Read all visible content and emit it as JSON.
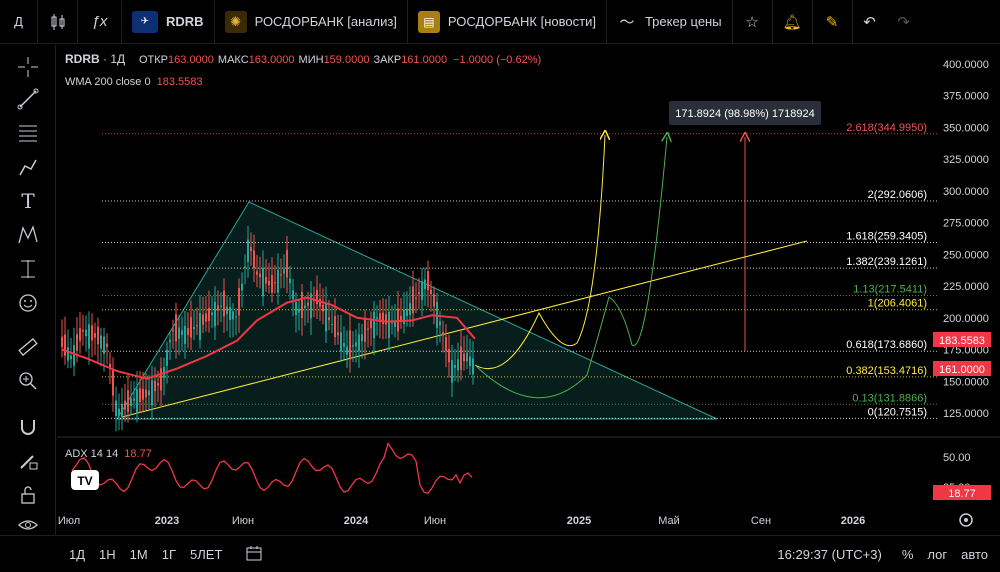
{
  "toolbar": {
    "menu_letter": "Д",
    "symbol": "RDRB",
    "analysis_label": "РОСДОРБАНК [анализ]",
    "news_label": "РОСДОРБАНК [новости]",
    "price_tracker_label": "Трекер цены"
  },
  "legend": {
    "symbol": "RDRB",
    "interval": "1Д",
    "open_label": "ОТКР",
    "open": "163.0000",
    "high_label": "МАКС",
    "high": "163.0000",
    "low_label": "МИН",
    "low": "159.0000",
    "close_label": "ЗАКР",
    "close": "161.0000",
    "change": "−1.0000 (−0.62%)",
    "wma_label": "WMA 200 close 0",
    "wma_value": "183.5583"
  },
  "adx": {
    "label": "ADX 14 14",
    "value": "18.77"
  },
  "price_axis": {
    "ticks": [
      "400.0000",
      "375.0000",
      "350.0000",
      "325.0000",
      "300.0000",
      "275.0000",
      "250.0000",
      "225.0000",
      "200.0000",
      "175.0000",
      "150.0000",
      "125.0000"
    ],
    "wma_tag": "183.5583",
    "close_tag": "161.0000"
  },
  "adx_axis": {
    "ticks": [
      "50.00",
      "25.00"
    ],
    "value_tag": "18.77"
  },
  "time_axis": {
    "ticks": [
      "Июл",
      "2023",
      "Июн",
      "2024",
      "Июн",
      "2025",
      "Май",
      "Сен",
      "2026"
    ]
  },
  "fib_levels": [
    {
      "label": "2.618(344.9950)",
      "color": "#ef5350"
    },
    {
      "label": "2(292.0606)",
      "color": "#ffffff"
    },
    {
      "label": "1.618(259.3405)",
      "color": "#ffffff"
    },
    {
      "label": "1.382(239.1261)",
      "color": "#ffffff"
    },
    {
      "label": "1.13(217.5411)",
      "color": "#4caf50"
    },
    {
      "label": "1(206.4061)",
      "color": "#ffeb3b"
    },
    {
      "label": "0.618(173.6860)",
      "color": "#ffffff"
    },
    {
      "label": "0.382(153.4716)",
      "color": "#ffeb3b"
    },
    {
      "label": "0.13(131.8866)",
      "color": "#4caf50"
    },
    {
      "label": "0(120.7515)",
      "color": "#ffffff"
    }
  ],
  "measure_label": "171.8924 (98.98%) 1718924",
  "bottom": {
    "ranges": [
      "1Д",
      "1Н",
      "1М",
      "1Г",
      "5ЛЕТ"
    ],
    "clock": "16:29:37 (UTC+3)",
    "percent": "%",
    "log": "лог",
    "auto": "авто"
  },
  "colors": {
    "wma": "#f23645",
    "fib_red": "#ef5350",
    "fib_yellow": "#ffeb3b",
    "fib_green": "#4caf50",
    "triangle": "#26a69a"
  },
  "chart_data": {
    "type": "line",
    "series": [
      {
        "name": "RDRB",
        "x": [
          "2022-07",
          "2022-10",
          "2023-01",
          "2023-04",
          "2023-06",
          "2023-09",
          "2024-01",
          "2024-04",
          "2024-06",
          "2024-08"
        ],
        "values": [
          175,
          165,
          128,
          185,
          260,
          215,
          170,
          195,
          200,
          161
        ]
      },
      {
        "name": "WMA 200 close 0",
        "x": [
          "2022-09",
          "2023-01",
          "2023-06",
          "2023-10",
          "2024-01",
          "2024-06",
          "2024-08"
        ],
        "values": [
          168,
          155,
          175,
          215,
          195,
          205,
          183.5583
        ]
      }
    ],
    "ylim": [
      110,
      410
    ]
  }
}
